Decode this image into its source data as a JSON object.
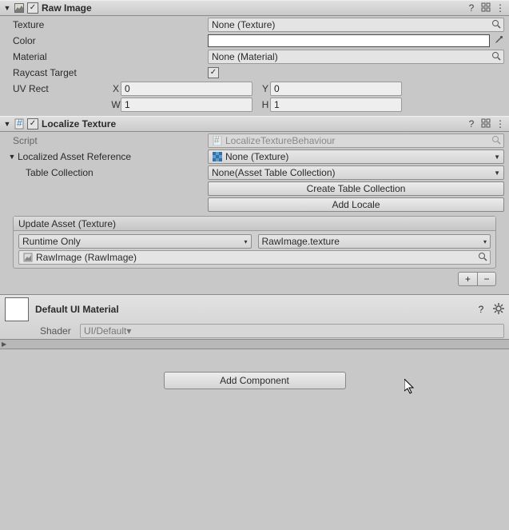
{
  "rawImage": {
    "title": "Raw Image",
    "enabled": true,
    "texture": {
      "label": "Texture",
      "value": "None (Texture)"
    },
    "color": {
      "label": "Color",
      "hex": "#ffffff",
      "alpha": 1.0
    },
    "material": {
      "label": "Material",
      "value": "None (Material)"
    },
    "raycastTarget": {
      "label": "Raycast Target",
      "checked": true
    },
    "uvRect": {
      "label": "UV Rect",
      "x": {
        "prefix": "X",
        "value": "0"
      },
      "y": {
        "prefix": "Y",
        "value": "0"
      },
      "w": {
        "prefix": "W",
        "value": "1"
      },
      "h": {
        "prefix": "H",
        "value": "1"
      }
    }
  },
  "localizeTexture": {
    "title": "Localize Texture",
    "enabled": true,
    "script": {
      "label": "Script",
      "value": "LocalizeTextureBehaviour"
    },
    "localizedAssetRef": {
      "label": "Localized Asset Reference",
      "value": "None (Texture)"
    },
    "tableCollection": {
      "label": "Table Collection",
      "value": "None(Asset Table Collection)"
    },
    "createTableBtn": "Create Table Collection",
    "addLocaleBtn": "Add Locale",
    "updateEvent": {
      "header": "Update Asset (Texture)",
      "mode": "Runtime Only",
      "target": "RawImage.texture",
      "object": "RawImage (RawImage)"
    }
  },
  "material": {
    "name": "Default UI Material",
    "shaderLabel": "Shader",
    "shaderValue": "UI/Default"
  },
  "addComponent": "Add Component",
  "icons": {
    "plus": "+",
    "minus": "−",
    "check": "✓"
  }
}
